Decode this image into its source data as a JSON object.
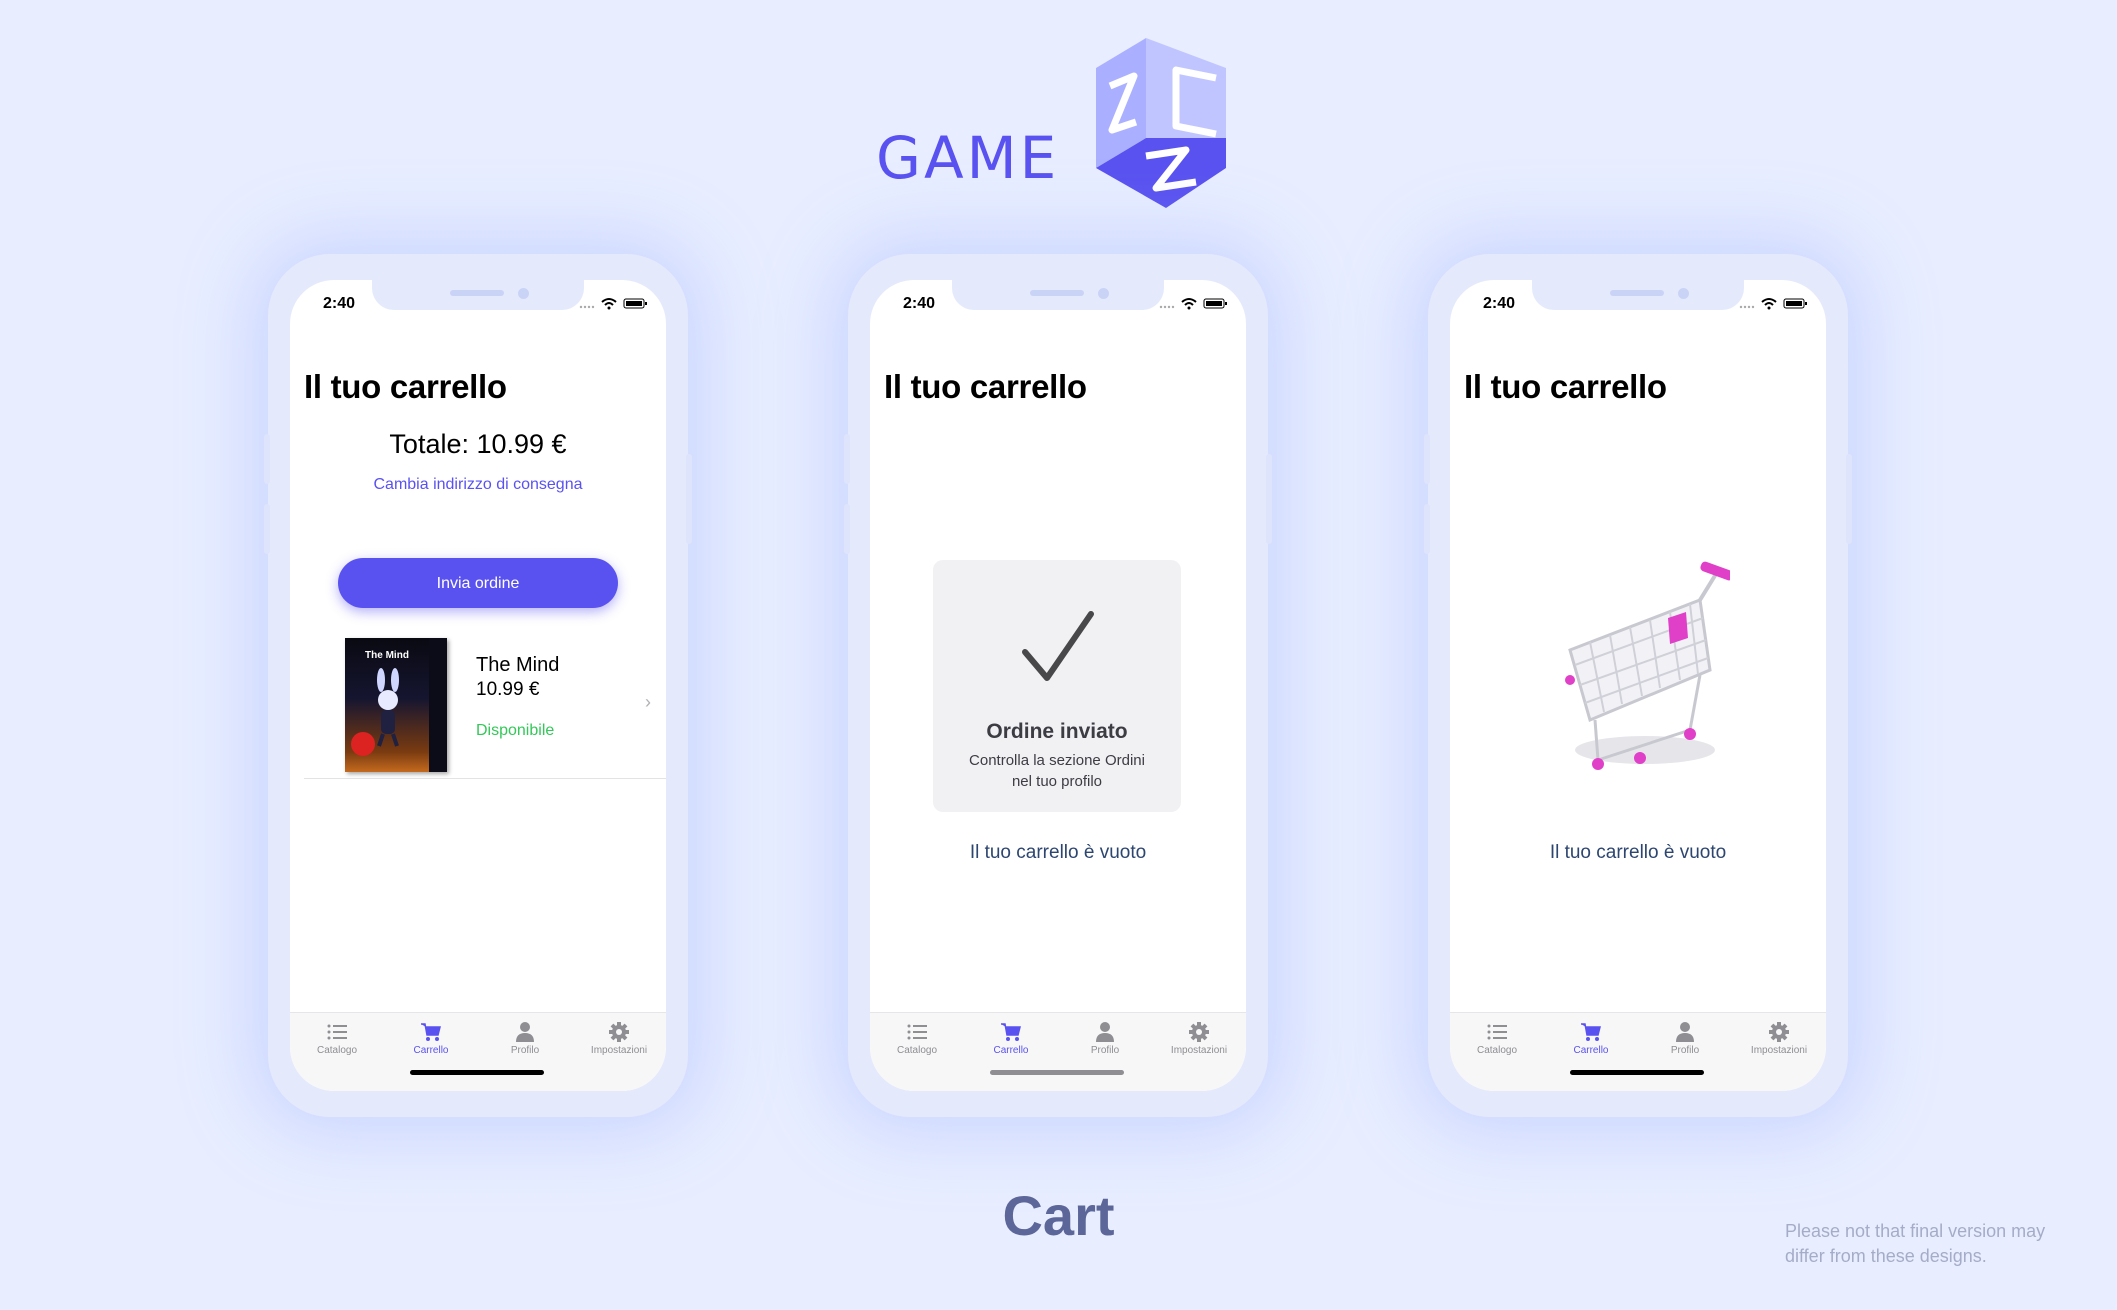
{
  "brand": {
    "word": "GAME",
    "accent": "#5a52f0"
  },
  "status_bar": {
    "time": "2:40"
  },
  "phones": [
    {
      "title": "Il tuo carrello",
      "total": "Totale: 10.99 €",
      "change_address": "Cambia indirizzo di consegna",
      "send_button": "Invia ordine",
      "item": {
        "name": "The Mind",
        "price": "10.99 €",
        "availability": "Disponibile",
        "box_title": "The Mind"
      }
    },
    {
      "title": "Il tuo carrello",
      "order_title": "Ordine inviato",
      "order_subtitle": "Controlla la sezione Ordini nel tuo profilo",
      "empty_text": "Il tuo carrello è vuoto"
    },
    {
      "title": "Il tuo carrello",
      "empty_text": "Il tuo carrello è vuoto"
    }
  ],
  "tabbar": {
    "items": [
      {
        "label": "Catalogo",
        "icon": "list-icon"
      },
      {
        "label": "Carrello",
        "icon": "cart-icon",
        "active": true
      },
      {
        "label": "Profilo",
        "icon": "person-icon"
      },
      {
        "label": "Impostazioni",
        "icon": "gear-icon"
      }
    ]
  },
  "footer": {
    "section_title": "Cart",
    "disclaimer": "Please not that final version may differ from these designs."
  },
  "colors": {
    "accent": "#5a52f0",
    "available": "#34c759",
    "background": "#e8eeff"
  }
}
